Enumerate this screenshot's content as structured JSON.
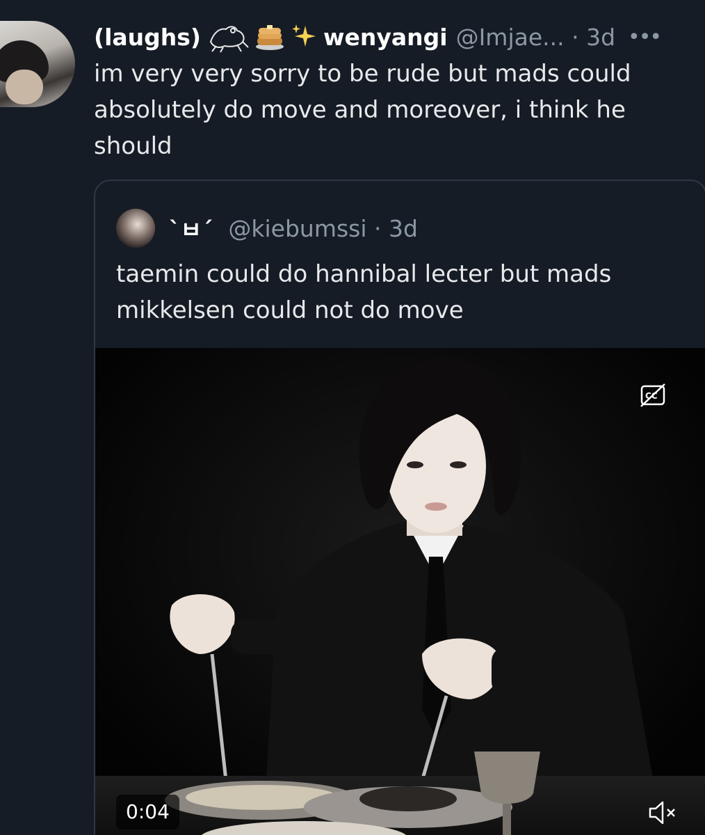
{
  "tweet": {
    "display_name": "(laughs)",
    "username_part": "wenyangi",
    "handle_time": "@Imjae... · 3d",
    "more": "•••",
    "text": "im very very sorry to be rude but mads could absolutely do move and moreover, i think he should",
    "icons": [
      "frog-icon",
      "pancake-icon",
      "sparkle-icon",
      "more-icon"
    ]
  },
  "quote": {
    "display_name": "`ㅂ´",
    "handle_time": "@kiebumssi · 3d",
    "text": "taemin could do hannibal lecter but mads mikkelsen could not do move",
    "media": {
      "timestamp": "0:04",
      "icons": [
        "closed-captions-off-icon",
        "muted-speaker-icon"
      ]
    }
  }
}
